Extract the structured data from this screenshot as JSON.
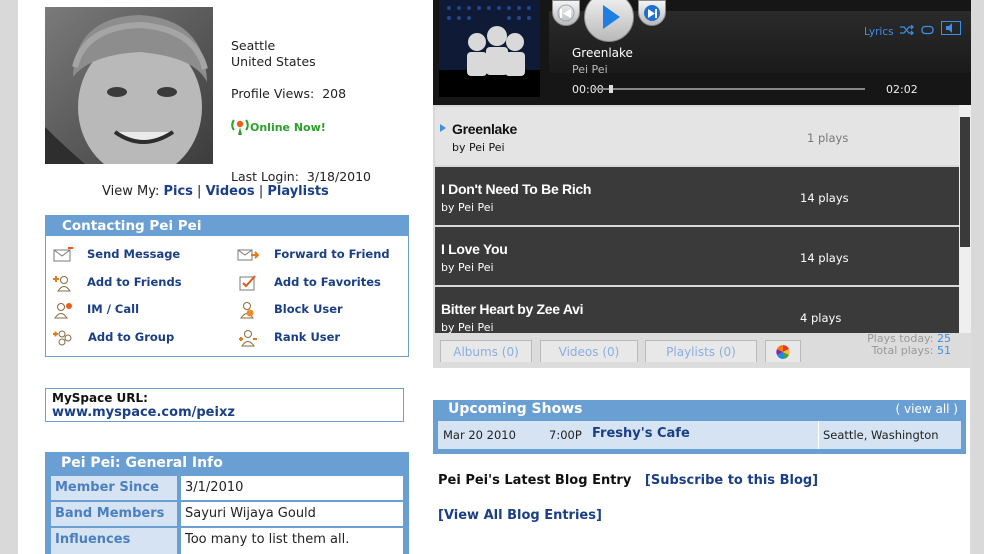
{
  "profile": {
    "city": "Seattle",
    "country": "United States",
    "views_label": "Profile Views:",
    "views_value": "208",
    "online": "Online Now!",
    "last_login_label": "Last Login:",
    "last_login_value": "3/18/2010",
    "view_my": "View My:",
    "view_links": [
      "Pics",
      "Videos",
      "Playlists"
    ],
    "sep": "|"
  },
  "contact": {
    "title": "Contacting Pei Pei",
    "items": [
      "Send Message",
      "Forward to Friend",
      "Add to Friends",
      "Add to Favorites",
      "IM / Call",
      "Block User",
      "Add to Group",
      "Rank User"
    ]
  },
  "url_box": {
    "label": "MySpace URL:",
    "value": "www.myspace.com/peixz"
  },
  "general": {
    "title": "Pei Pei: General Info",
    "rows": [
      {
        "key": "Member Since",
        "value": "3/1/2010"
      },
      {
        "key": "Band Members",
        "value": "Sayuri Wijaya Gould"
      },
      {
        "key": "Influences",
        "value": "Too many to list them all."
      }
    ]
  },
  "player": {
    "now_title": "Greenlake",
    "now_artist": "Pei Pei",
    "time_current": "00:00",
    "time_total": "02:02",
    "lyrics": "Lyrics",
    "songs": [
      {
        "title": "Greenlake",
        "by": "by Pei Pei",
        "plays": "1 plays",
        "style": "light"
      },
      {
        "title": "I Don't Need To Be Rich",
        "by": "by Pei Pei",
        "plays": "14 plays",
        "style": "dark"
      },
      {
        "title": "I Love You",
        "by": "by Pei Pei",
        "plays": "14 plays",
        "style": "dark"
      },
      {
        "title": "Bitter Heart by Zee Avi",
        "by": "by Pei Pei",
        "plays": "4 plays",
        "style": "dark"
      }
    ],
    "tabs": [
      "Albums (0)",
      "Videos (0)",
      "Playlists (0)"
    ],
    "plays_today_label": "Plays today:",
    "plays_today": "25",
    "total_plays_label": "Total plays:",
    "total_plays": "51"
  },
  "shows": {
    "title": "Upcoming Shows",
    "view_all": "( view all )",
    "rows": [
      {
        "date": "Mar 20 2010",
        "time": "7:00P",
        "venue": "Freshy's Cafe",
        "location": "Seattle, Washington"
      }
    ]
  },
  "blog": {
    "heading": "Pei Pei's Latest Blog Entry",
    "subscribe": "[Subscribe to this Blog]",
    "view_all": "[View All Blog Entries]"
  },
  "colors": {
    "link": "#1a3f86",
    "box_header": "#6a9fd3",
    "online": "#2aa12a",
    "player_accent": "#3f8fe4"
  }
}
